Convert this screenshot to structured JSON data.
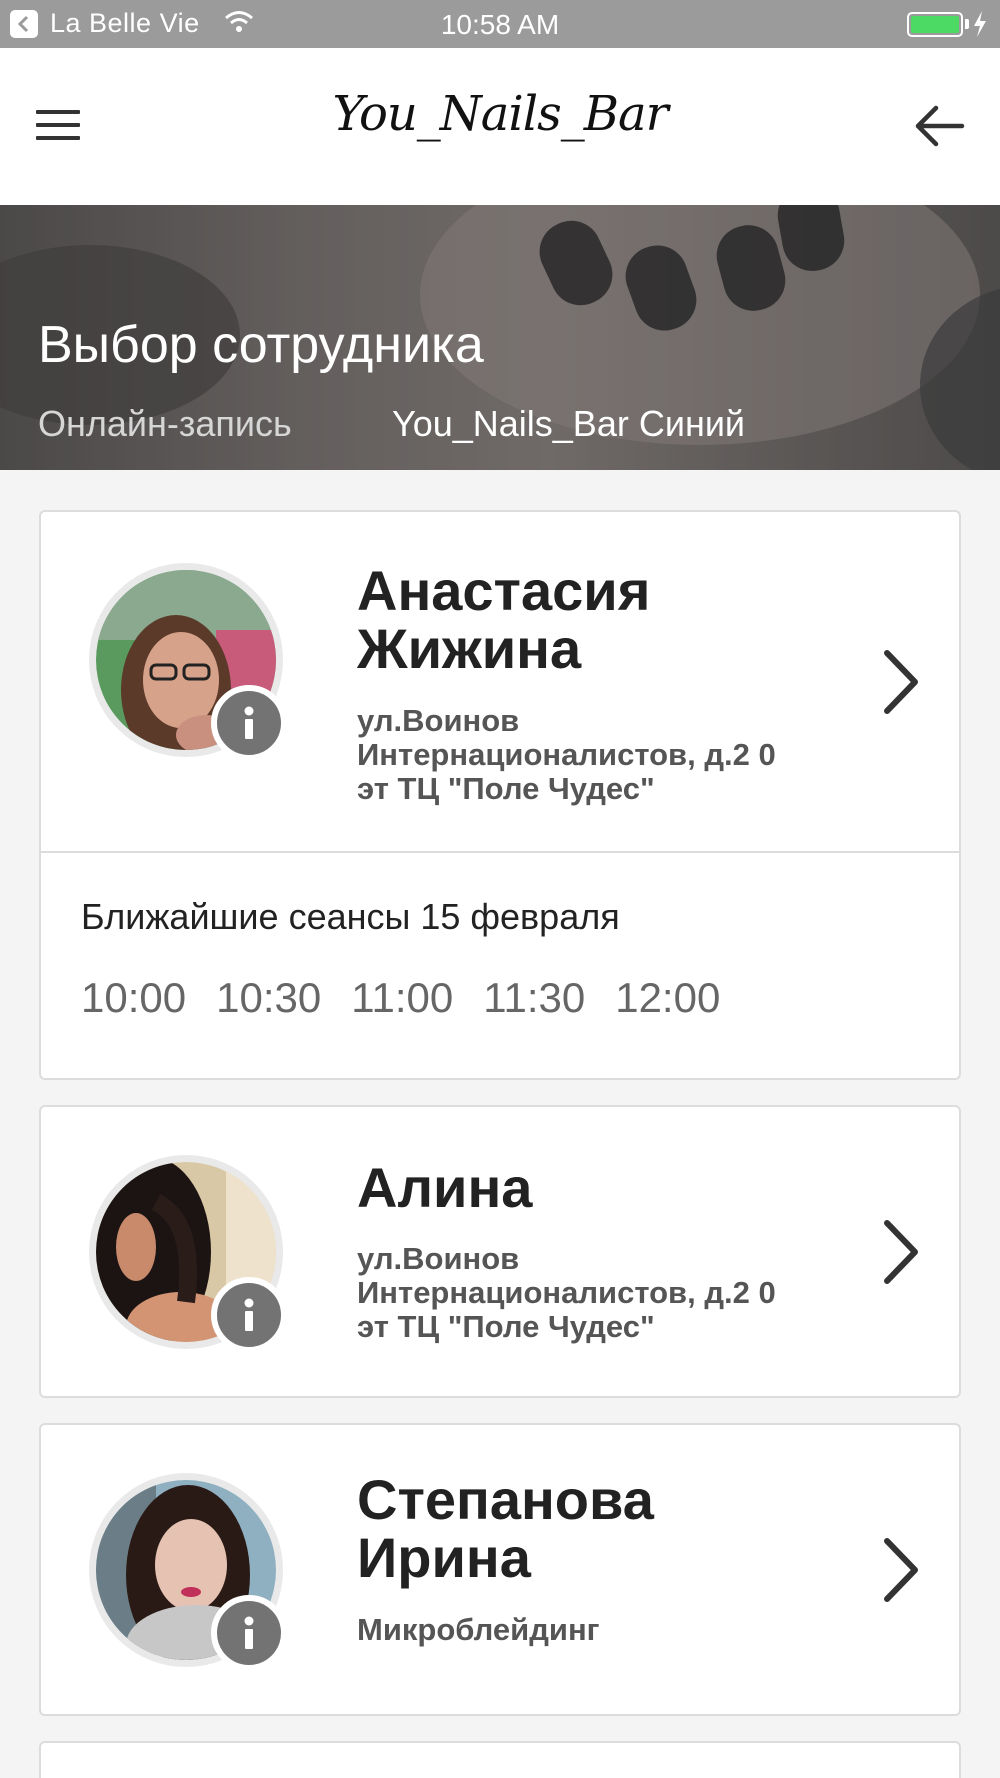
{
  "status_bar": {
    "back_app": "La Belle Vie",
    "time": "10:58 AM",
    "battery_level": 1.0
  },
  "header": {
    "logo": "You_Nails_Bar",
    "menu_icon": "hamburger-menu-icon",
    "back_icon": "arrow-left-icon"
  },
  "hero": {
    "title": "Выбор сотрудника",
    "breadcrumb": "Онлайн-запись",
    "salon": "You_Nails_Bar Синий"
  },
  "employees": [
    {
      "name": "Анастасия Жижина",
      "name_lines": [
        "Анастасия",
        "Жижина"
      ],
      "address_lines": [
        "ул.Воинов",
        "Интернационалистов, д.2 0",
        "эт ТЦ \"Поле Чудес\""
      ],
      "sessions_label": "Ближайшие сеансы 15 февраля",
      "slots": [
        "10:00",
        "10:30",
        "11:00",
        "11:30",
        "12:00"
      ]
    },
    {
      "name": "Алина",
      "name_lines": [
        "Алина"
      ],
      "address_lines": [
        "ул.Воинов",
        "Интернационалистов, д.2 0",
        "эт ТЦ \"Поле Чудес\""
      ]
    },
    {
      "name": "Степанова Ирина",
      "name_lines": [
        "Степанова",
        "Ирина"
      ],
      "address_lines": [
        "Микроблейдинг"
      ]
    }
  ],
  "colors": {
    "status_bar": "#9b9b9b",
    "battery": "#4cd964",
    "info_badge": "#737373",
    "background": "#f4f4f4"
  }
}
